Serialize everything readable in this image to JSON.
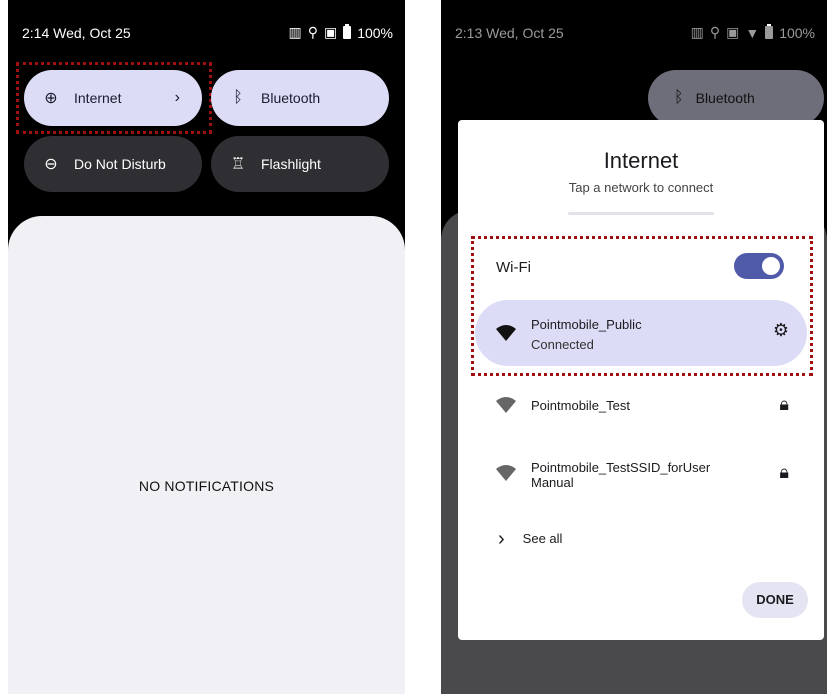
{
  "left": {
    "status": {
      "time": "2:14 Wed, Oct 25",
      "battery": "100%"
    },
    "tiles": {
      "internet": "Internet",
      "bluetooth": "Bluetooth",
      "dnd": "Do Not Disturb",
      "flashlight": "Flashlight"
    },
    "shade": {
      "empty_text": "NO NOTIFICATIONS"
    }
  },
  "right": {
    "status": {
      "time": "2:13 Wed, Oct 25",
      "battery": "100%"
    },
    "bg_tile": "Bluetooth",
    "dialog": {
      "title": "Internet",
      "subtitle": "Tap a network to connect",
      "wifi_label": "Wi-Fi",
      "wifi_on": true,
      "networks": [
        {
          "name": "Pointmobile_Public",
          "status": "Connected",
          "icon": "gear-icon"
        },
        {
          "name": "Pointmobile_Test",
          "status": "",
          "icon": "lock-icon"
        },
        {
          "name": "Pointmobile_TestSSID_forUser\nManual",
          "status": "",
          "icon": "lock-icon"
        }
      ],
      "see_all": "See all",
      "done": "DONE"
    }
  }
}
